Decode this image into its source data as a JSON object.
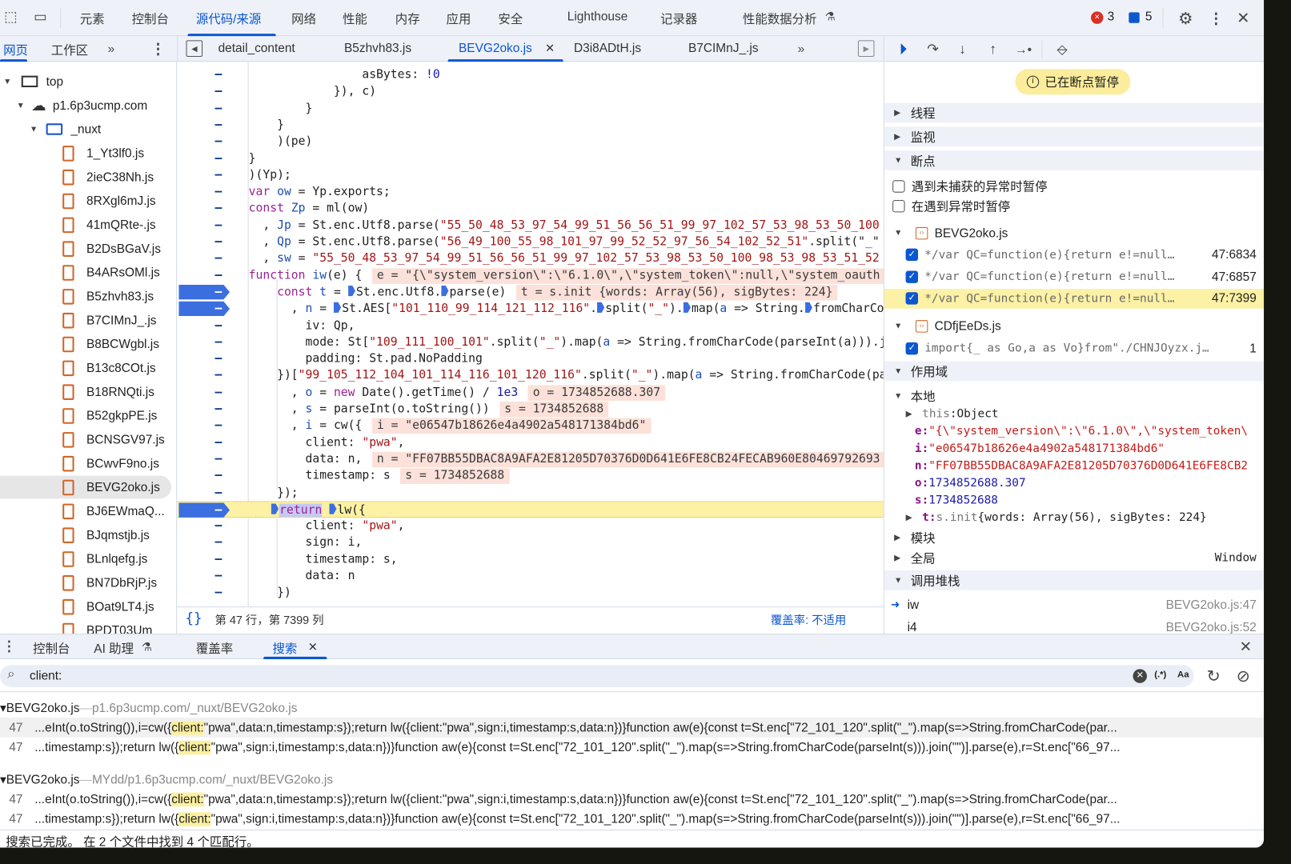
{
  "toolbar": {
    "tabs": [
      "元素",
      "控制台",
      "源代码/来源",
      "网络",
      "性能",
      "内存",
      "应用",
      "安全",
      "Lighthouse",
      "记录器",
      "性能数据分析"
    ],
    "active_tab": "源代码/来源",
    "error_count": "3",
    "message_count": "5",
    "colors": {
      "accent": "#0b57d0",
      "error": "#d93025"
    }
  },
  "navigator": {
    "tabs": [
      "网页",
      "工作区"
    ],
    "active_tab": "网页",
    "tree": {
      "top": "top",
      "domain": "p1.6p3ucmp.com",
      "folder": "_nuxt",
      "files": [
        "1_Yt3lf0.js",
        "2ieC38Nh.js",
        "8RXgl6mJ.js",
        "41mQRte-.js",
        "B2DsBGaV.js",
        "B4ARsOMl.js",
        "B5zhvh83.js",
        "B7CIMnJ_.js",
        "B8BCWgbl.js",
        "B13c8COt.js",
        "B18RNQti.js",
        "B52gkpPE.js",
        "BCNSGV97.js",
        "BCwvF9no.js",
        "BEVG2oko.js",
        "BJ6EWmaQ...",
        "BJqmstjb.js",
        "BLnlqefg.js",
        "BN7DbRjP.js",
        "BOat9LT4.js",
        "BPDT03Um"
      ],
      "selected": "BEVG2oko.js"
    }
  },
  "editor": {
    "tabs": [
      "detail_content",
      "B5zhvh83.js",
      "BEVG2oko.js",
      "D3i8ADtH.js",
      "B7CIMnJ_.js"
    ],
    "active_tab": "BEVG2oko.js",
    "lines": [
      {
        "seg": [
          [
            "p",
            "                asBytes: "
          ],
          [
            "n",
            "!0"
          ]
        ]
      },
      {
        "seg": [
          [
            "p",
            "            }), c)"
          ]
        ]
      },
      {
        "seg": [
          [
            "p",
            "        }"
          ]
        ]
      },
      {
        "seg": [
          [
            "p",
            "    }"
          ]
        ]
      },
      {
        "seg": [
          [
            "p",
            "    )(pe)"
          ]
        ]
      },
      {
        "seg": [
          [
            "p",
            "}"
          ]
        ]
      },
      {
        "seg": [
          [
            "p",
            ")(Yp);"
          ]
        ]
      },
      {
        "seg": [
          [
            "k",
            "var "
          ],
          [
            "v",
            "ow"
          ],
          [
            "p",
            " = Yp.exports;"
          ]
        ]
      },
      {
        "seg": [
          [
            "k",
            "const "
          ],
          [
            "v",
            "Zp"
          ],
          [
            "p",
            " = ml(ow)"
          ]
        ]
      },
      {
        "seg": [
          [
            "p",
            "  , "
          ],
          [
            "v",
            "Jp"
          ],
          [
            "p",
            " = St.enc.Utf8.parse("
          ],
          [
            "s",
            "\"55_50_48_53_97_54_99_51_56_56_51_99_97_102_57_53_98_53_50_100"
          ]
        ]
      },
      {
        "seg": [
          [
            "p",
            "  , "
          ],
          [
            "v",
            "Qp"
          ],
          [
            "p",
            " = St.enc.Utf8.parse("
          ],
          [
            "s",
            "\"56_49_100_55_98_101_97_99_52_52_97_56_54_102_52_51\""
          ],
          [
            "p",
            ".split(\""
          ],
          [
            "s",
            "_"
          ],
          [
            "p",
            "\""
          ]
        ]
      },
      {
        "seg": [
          [
            "p",
            "  , "
          ],
          [
            "v",
            "sw"
          ],
          [
            "p",
            " = "
          ],
          [
            "s",
            "\"55_50_48_53_97_54_99_51_56_56_51_99_97_102_57_53_98_53_50_100_98_53_98_53_51_52"
          ]
        ]
      },
      {
        "seg": [
          [
            "k",
            "function "
          ],
          [
            "v",
            "iw"
          ],
          [
            "p",
            "(e) {"
          ]
        ],
        "inline": "e = \"{\\\"system_version\\\":\\\"6.1.0\\\",\\\"system_token\\\":null,\\\"system_oauth"
      },
      {
        "seg": [
          [
            "p",
            "    "
          ],
          [
            "k",
            "const "
          ],
          [
            "v",
            "t"
          ],
          [
            "p",
            " = "
          ],
          [
            "mark",
            ""
          ],
          [
            "p",
            "St.enc.Utf8."
          ],
          [
            "mark",
            ""
          ],
          [
            "p",
            "parse(e)"
          ]
        ],
        "inline": "t = s.init {words: Array(56), sigBytes: 224}",
        "bp": true
      },
      {
        "seg": [
          [
            "p",
            "      , "
          ],
          [
            "v",
            "n"
          ],
          [
            "p",
            " = "
          ],
          [
            "mark",
            ""
          ],
          [
            "p",
            "St.AES["
          ],
          [
            "s",
            "\"101_110_99_114_121_112_116\""
          ],
          [
            "p",
            "."
          ],
          [
            "mark",
            ""
          ],
          [
            "p",
            "split("
          ],
          [
            "s",
            "\"_\""
          ],
          [
            "p",
            ")."
          ],
          [
            "mark",
            ""
          ],
          [
            "p",
            "map("
          ],
          [
            "v",
            "a"
          ],
          [
            "p",
            " => String."
          ],
          [
            "mark",
            ""
          ],
          [
            "p",
            "fromCharCode(parseInt(a))).join(\"\")]"
          ]
        ],
        "bp": true
      },
      {
        "seg": [
          [
            "p",
            "        iv: Qp,"
          ]
        ]
      },
      {
        "seg": [
          [
            "p",
            "        mode: St["
          ],
          [
            "s",
            "\"109_111_100_101\""
          ],
          [
            "p",
            ".split("
          ],
          [
            "s",
            "\"_\""
          ],
          [
            "p",
            ").map("
          ],
          [
            "v",
            "a"
          ],
          [
            "p",
            " => String.fromCharCode(parseInt(a))).join(\"\")],"
          ]
        ]
      },
      {
        "seg": [
          [
            "p",
            "        padding: St.pad.NoPadding"
          ]
        ]
      },
      {
        "seg": [
          [
            "p",
            "    })["
          ],
          [
            "s",
            "\"99_105_112_104_101_114_116_101_120_116\""
          ],
          [
            "p",
            ".split("
          ],
          [
            "s",
            "\"_\""
          ],
          [
            "p",
            ").map("
          ],
          [
            "v",
            "a"
          ],
          [
            "p",
            " => String.fromCharCode(parseInt(a))).join(\"\")]"
          ]
        ]
      },
      {
        "seg": [
          [
            "p",
            "      , "
          ],
          [
            "v",
            "o"
          ],
          [
            "p",
            " = "
          ],
          [
            "k",
            "new "
          ],
          [
            "p",
            "Date().getTime() / "
          ],
          [
            "n",
            "1e3"
          ]
        ],
        "inline": "o = 1734852688.307"
      },
      {
        "seg": [
          [
            "p",
            "      , "
          ],
          [
            "v",
            "s"
          ],
          [
            "p",
            " = parseInt(o.toString())"
          ]
        ],
        "inline": "s = 1734852688"
      },
      {
        "seg": [
          [
            "p",
            "      , "
          ],
          [
            "v",
            "i"
          ],
          [
            "p",
            " = cw({"
          ]
        ],
        "inline": "i = \"e06547b18626e4a4902a548171384bd6\""
      },
      {
        "seg": [
          [
            "p",
            "        client: "
          ],
          [
            "s",
            "\"pwa\""
          ],
          [
            "p",
            ","
          ]
        ]
      },
      {
        "seg": [
          [
            "p",
            "        data: n,"
          ]
        ],
        "inline": "n = \"FF07BB55DBAC8A9AFA2E81205D70376D0D641E6FE8CB24FECAB960E80469792693"
      },
      {
        "seg": [
          [
            "p",
            "        timestamp: s"
          ]
        ],
        "inline": "s = 1734852688"
      },
      {
        "seg": [
          [
            "p",
            "    });"
          ]
        ]
      },
      {
        "seg": [
          [
            "p",
            "    "
          ],
          [
            "mark",
            ""
          ],
          [
            "k",
            "return"
          ],
          [
            "p",
            " "
          ],
          [
            "mark",
            ""
          ],
          [
            "p",
            "lw({"
          ]
        ],
        "bp": true,
        "current": true
      },
      {
        "seg": [
          [
            "p",
            "        client: "
          ],
          [
            "s",
            "\"pwa\""
          ],
          [
            "p",
            ","
          ]
        ]
      },
      {
        "seg": [
          [
            "p",
            "        sign: i,"
          ]
        ]
      },
      {
        "seg": [
          [
            "p",
            "        timestamp: s,"
          ]
        ]
      },
      {
        "seg": [
          [
            "p",
            "        data: n"
          ]
        ]
      },
      {
        "seg": [
          [
            "p",
            "    })"
          ]
        ]
      }
    ],
    "status": {
      "position": "第 47 行，第 7399 列",
      "coverage": "覆盖率: 不适用"
    }
  },
  "debugger": {
    "paused_label": "已在断点暂停",
    "sections": {
      "threads": "线程",
      "watch": "监视",
      "breakpoints": "断点",
      "scope": "作用域",
      "callstack": "调用堆栈"
    },
    "pause_options": [
      {
        "label": "遇到未捕获的异常时暂停",
        "checked": false
      },
      {
        "label": "在遇到异常时暂停",
        "checked": false
      }
    ],
    "breakpoint_groups": [
      {
        "file": "BEVG2oko.js",
        "items": [
          {
            "code": "*/var QC=function(e){return e!=null…",
            "location": "47:6834",
            "checked": true
          },
          {
            "code": "*/var QC=function(e){return e!=null…",
            "location": "47:6857",
            "checked": true
          },
          {
            "code": "*/var QC=function(e){return e!=null…",
            "location": "47:7399",
            "checked": true,
            "active": true
          }
        ]
      },
      {
        "file": "CDfjEeDs.js",
        "items": [
          {
            "code": "import{_ as Go,a as Vo}from\"./CHNJOyzx.j…",
            "location": "1",
            "checked": true
          }
        ]
      }
    ],
    "scope": {
      "local_label": "本地",
      "this_key": "this",
      "this_value": "Object",
      "vars": [
        {
          "key": "e",
          "value": "\"{\\\"system_version\\\":\\\"6.1.0\\\",\\\"system_token\\",
          "type": "string"
        },
        {
          "key": "i",
          "value": "\"e06547b18626e4a4902a548171384bd6\"",
          "type": "string"
        },
        {
          "key": "n",
          "value": "\"FF07BB55DBAC8A9AFA2E81205D70376D0D641E6FE8CB2",
          "type": "string"
        },
        {
          "key": "o",
          "value": "1734852688.307",
          "type": "number"
        },
        {
          "key": "s",
          "value": "1734852688",
          "type": "number"
        }
      ],
      "t_key": "t",
      "t_prefix": "s.init",
      "t_value": "{words: Array(56), sigBytes: 224}",
      "module_label": "模块",
      "global_label": "全局",
      "global_value": "Window"
    },
    "callstack": [
      {
        "name": "iw",
        "location": "BEVG2oko.js:47",
        "current": true
      },
      {
        "name": "i4",
        "location": "BEVG2oko.js:52"
      }
    ]
  },
  "drawer": {
    "tabs": [
      "控制台",
      "AI 助理",
      "覆盖率",
      "搜索"
    ],
    "active_tab": "搜索",
    "search_query": "client:",
    "regex_label": "(.*)",
    "case_label": "Aa",
    "results": [
      {
        "file": "BEVG2oko.js",
        "path": "p1.6p3ucmp.com/_nuxt/BEVG2oko.js",
        "matches": [
          {
            "line": "47",
            "before": "...eInt(o.toString()),i=cw({",
            "match": "client:",
            "after": "\"pwa\",data:n,timestamp:s});return lw({client:\"pwa\",sign:i,timestamp:s,data:n})}function aw(e){const t=St.enc[\"72_101_120\".split(\"_\").map(s=>String.fromCharCode(par..."
          },
          {
            "line": "47",
            "before": "...timestamp:s});return lw({",
            "match": "client:",
            "after": "\"pwa\",sign:i,timestamp:s,data:n})}function aw(e){const t=St.enc[\"72_101_120\".split(\"_\").map(s=>String.fromCharCode(parseInt(s))).join(\"\")].parse(e),r=St.enc[\"66_97..."
          }
        ]
      },
      {
        "file": "BEVG2oko.js",
        "path": "MYdd/p1.6p3ucmp.com/_nuxt/BEVG2oko.js",
        "matches": [
          {
            "line": "47",
            "before": "...eInt(o.toString()),i=cw({",
            "match": "client:",
            "after": "\"pwa\",data:n,timestamp:s});return lw({client:\"pwa\",sign:i,timestamp:s,data:n})}function aw(e){const t=St.enc[\"72_101_120\".split(\"_\").map(s=>String.fromCharCode(par..."
          },
          {
            "line": "47",
            "before": "...timestamp:s});return lw({",
            "match": "client:",
            "after": "\"pwa\",sign:i,timestamp:s,data:n})}function aw(e){const t=St.enc[\"72_101_120\".split(\"_\").map(s=>String.fromCharCode(parseInt(s))).join(\"\")].parse(e),r=St.enc[\"66_97..."
          }
        ]
      }
    ],
    "status": "搜索已完成。 在 2 个文件中找到 4 个匹配行。"
  }
}
